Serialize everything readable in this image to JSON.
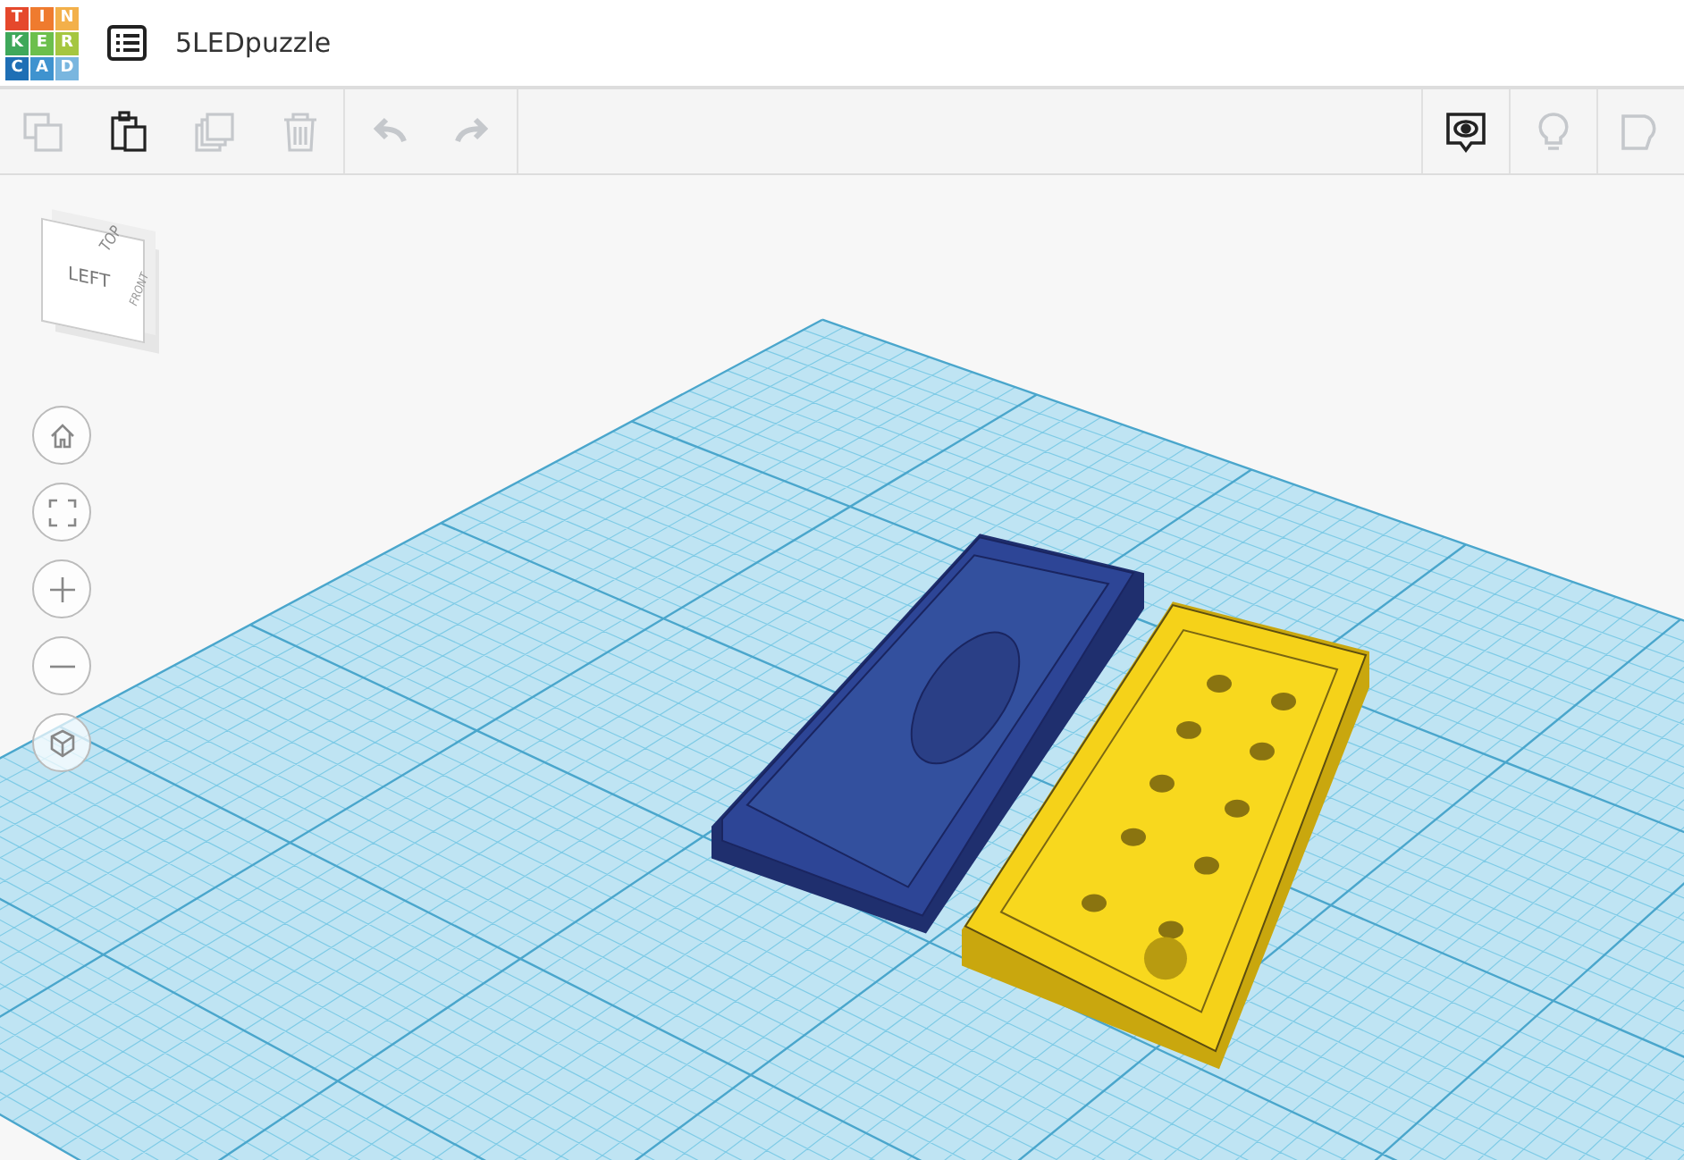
{
  "header": {
    "logo": [
      {
        "char": "T",
        "color": "#e5482c"
      },
      {
        "char": "I",
        "color": "#ef7b2e"
      },
      {
        "char": "N",
        "color": "#f3b04a"
      },
      {
        "char": "K",
        "color": "#3fa85a"
      },
      {
        "char": "E",
        "color": "#6cbf4c"
      },
      {
        "char": "R",
        "color": "#a5c640"
      },
      {
        "char": "C",
        "color": "#1f6fb5"
      },
      {
        "char": "A",
        "color": "#3f93cf"
      },
      {
        "char": "D",
        "color": "#79b6df"
      }
    ],
    "title": "5LEDpuzzle"
  },
  "toolbar": {
    "left": [
      {
        "kind": "copy",
        "disabled": true
      },
      {
        "kind": "paste",
        "disabled": false
      },
      {
        "kind": "duplicate",
        "disabled": true
      },
      {
        "kind": "delete",
        "disabled": true
      },
      {
        "kind": "undo",
        "disabled": true
      },
      {
        "kind": "redo",
        "disabled": true
      }
    ],
    "right": [
      {
        "kind": "notes",
        "disabled": false
      },
      {
        "kind": "hint",
        "disabled": true
      },
      {
        "kind": "shape",
        "disabled": true
      }
    ]
  },
  "view_cube": {
    "top": "TOP",
    "left": "LEFT",
    "front": "FRONT"
  },
  "nav_controls": [
    {
      "kind": "home"
    },
    {
      "kind": "fit"
    },
    {
      "kind": "zoom_in"
    },
    {
      "kind": "zoom_out"
    },
    {
      "kind": "ortho"
    }
  ]
}
